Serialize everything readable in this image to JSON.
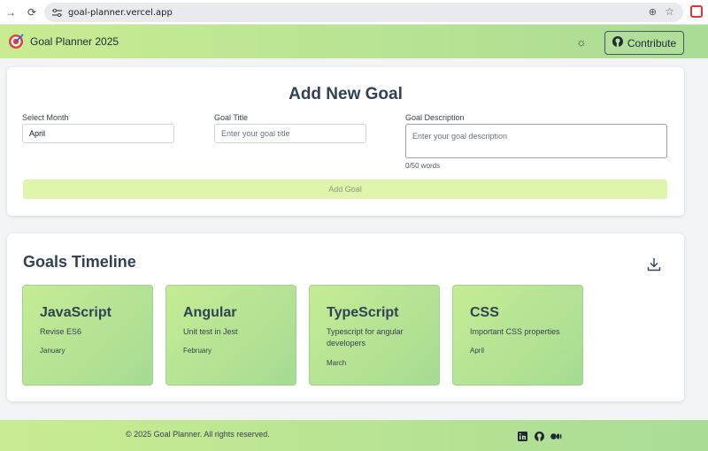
{
  "browser": {
    "url": "goal-planner.vercel.app"
  },
  "header": {
    "title": "Goal Planner 2025",
    "contribute_label": "Contribute"
  },
  "add_goal": {
    "title": "Add New Goal",
    "month_label": "Select Month",
    "month_value": "April",
    "title_label": "Goal Title",
    "title_placeholder": "Enter your goal title",
    "description_label": "Goal Description",
    "description_placeholder": "Enter your goal description",
    "word_count": "0/50 words",
    "add_button": "Add Goal"
  },
  "timeline": {
    "title": "Goals Timeline",
    "goals": [
      {
        "title": "JavaScript",
        "description": "Revise ES6",
        "month": "January"
      },
      {
        "title": "Angular",
        "description": "Unit test in Jest",
        "month": "February"
      },
      {
        "title": "TypeScript",
        "description": "Typescript for angular developers",
        "month": "March"
      },
      {
        "title": "CSS",
        "description": "Important CSS properties",
        "month": "April"
      }
    ]
  },
  "footer": {
    "copyright": "© 2025 Goal Planner. All rights reserved."
  },
  "colors": {
    "header_gradient_start": "#c9ec92",
    "header_gradient_end": "#a9dc95",
    "add_button_bg": "#dff5ac",
    "card_gradient_start": "#c5ec94",
    "card_gradient_end": "#a6db93"
  }
}
